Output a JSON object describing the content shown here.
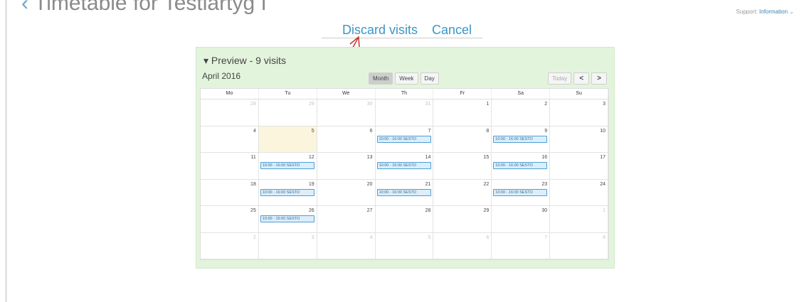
{
  "page": {
    "title": "Timetable for Testlartyg I",
    "support_label": "Support:",
    "support_link": "Information"
  },
  "actions": {
    "discard": "Discard visits",
    "cancel": "Cancel"
  },
  "preview": {
    "title": "Preview - 9 visits",
    "month": "April 2016",
    "views": [
      "Month",
      "Week",
      "Day"
    ],
    "active_view": "Month",
    "today_label": "Today",
    "prev_label": "<",
    "next_label": ">"
  },
  "calendar": {
    "weekdays": [
      "Mo",
      "Tu",
      "We",
      "Th",
      "Fr",
      "Sa",
      "Su"
    ],
    "today": "5",
    "weeks": [
      [
        {
          "d": "28",
          "other": true
        },
        {
          "d": "29",
          "other": true
        },
        {
          "d": "30",
          "other": true
        },
        {
          "d": "31",
          "other": true
        },
        {
          "d": "1"
        },
        {
          "d": "2"
        },
        {
          "d": "3"
        }
      ],
      [
        {
          "d": "4"
        },
        {
          "d": "5"
        },
        {
          "d": "6"
        },
        {
          "d": "7",
          "event": "10:00 - 16:00 SESTO"
        },
        {
          "d": "8"
        },
        {
          "d": "9",
          "event": "10:00 - 16:00 SESTO"
        },
        {
          "d": "10"
        }
      ],
      [
        {
          "d": "11"
        },
        {
          "d": "12",
          "event": "10:00 - 16:00 SESTO"
        },
        {
          "d": "13"
        },
        {
          "d": "14",
          "event": "10:00 - 16:00 SESTO"
        },
        {
          "d": "15"
        },
        {
          "d": "16",
          "event": "10:00 - 16:00 SESTO"
        },
        {
          "d": "17"
        }
      ],
      [
        {
          "d": "18"
        },
        {
          "d": "19",
          "event": "10:00 - 16:00 SESTO"
        },
        {
          "d": "20"
        },
        {
          "d": "21",
          "event": "10:00 - 16:00 SESTO"
        },
        {
          "d": "22"
        },
        {
          "d": "23",
          "event": "10:00 - 16:00 SESTO"
        },
        {
          "d": "24"
        }
      ],
      [
        {
          "d": "25"
        },
        {
          "d": "26",
          "event": "10:00 - 16:00 SESTO"
        },
        {
          "d": "27"
        },
        {
          "d": "28"
        },
        {
          "d": "29"
        },
        {
          "d": "30"
        },
        {
          "d": "1",
          "other": true
        }
      ],
      [
        {
          "d": "2",
          "other": true
        },
        {
          "d": "3",
          "other": true
        },
        {
          "d": "4",
          "other": true
        },
        {
          "d": "5",
          "other": true
        },
        {
          "d": "6",
          "other": true
        },
        {
          "d": "7",
          "other": true
        },
        {
          "d": "8",
          "other": true
        }
      ]
    ]
  },
  "colors": {
    "accent": "#3a97c6",
    "panel_bg": "#e3f4dc",
    "today_bg": "#fcf5dd",
    "event_border": "#4f9ed2",
    "annotation_arrow": "#c0392b"
  }
}
